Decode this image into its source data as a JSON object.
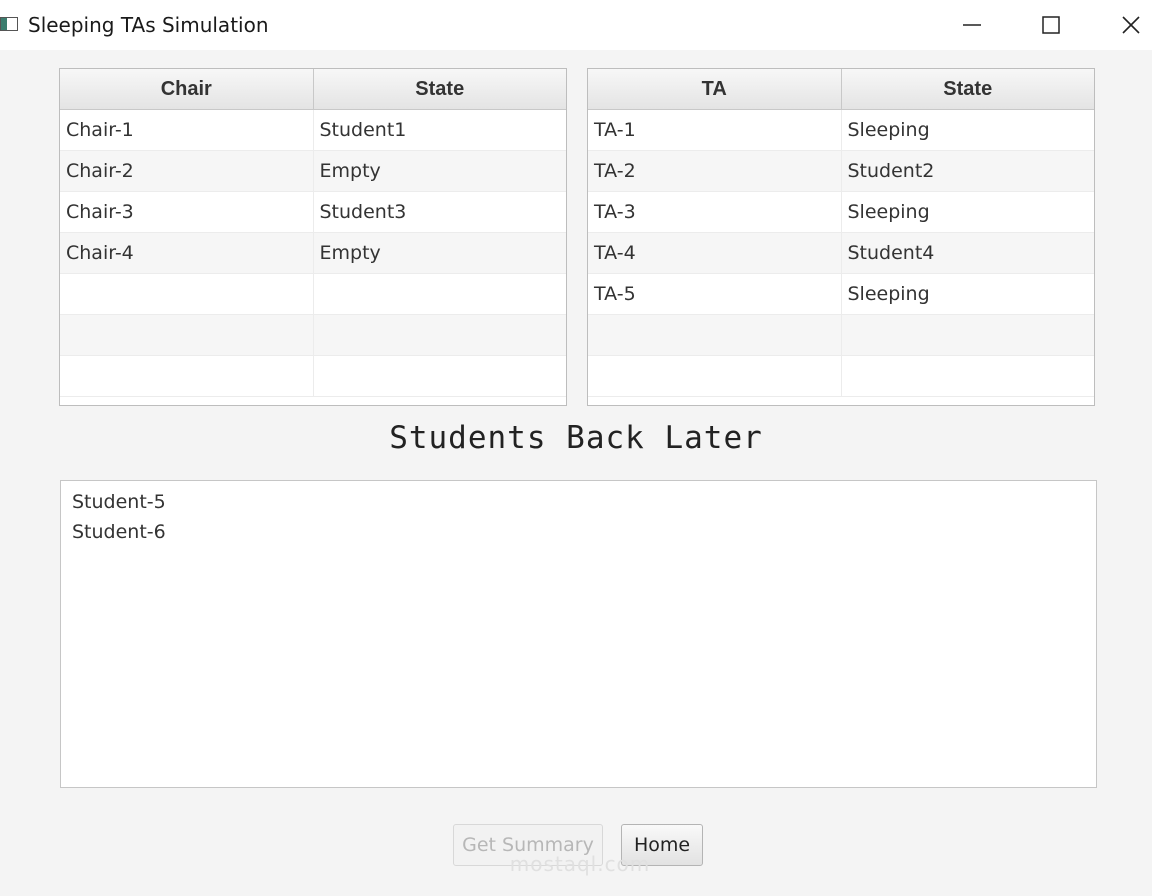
{
  "window": {
    "title": "Sleeping TAs Simulation"
  },
  "chairs_table": {
    "headers": [
      "Chair",
      "State"
    ],
    "rows": [
      [
        "Chair-1",
        "Student1"
      ],
      [
        "Chair-2",
        "Empty"
      ],
      [
        "Chair-3",
        "Student3"
      ],
      [
        "Chair-4",
        "Empty"
      ]
    ]
  },
  "tas_table": {
    "headers": [
      "TA",
      "State"
    ],
    "rows": [
      [
        "TA-1",
        "Sleeping"
      ],
      [
        "TA-2",
        "Student2"
      ],
      [
        "TA-3",
        "Sleeping"
      ],
      [
        "TA-4",
        "Student4"
      ],
      [
        "TA-5",
        "Sleeping"
      ]
    ]
  },
  "students_back_later": {
    "heading": "Students Back Later",
    "items": [
      "Student-5",
      "Student-6"
    ]
  },
  "buttons": {
    "get_summary": "Get Summary",
    "home": "Home"
  },
  "watermark": "mostaql.com",
  "icons": {
    "app": "app-window-icon",
    "minimize": "minimize-icon",
    "maximize": "maximize-icon",
    "close": "close-icon"
  }
}
